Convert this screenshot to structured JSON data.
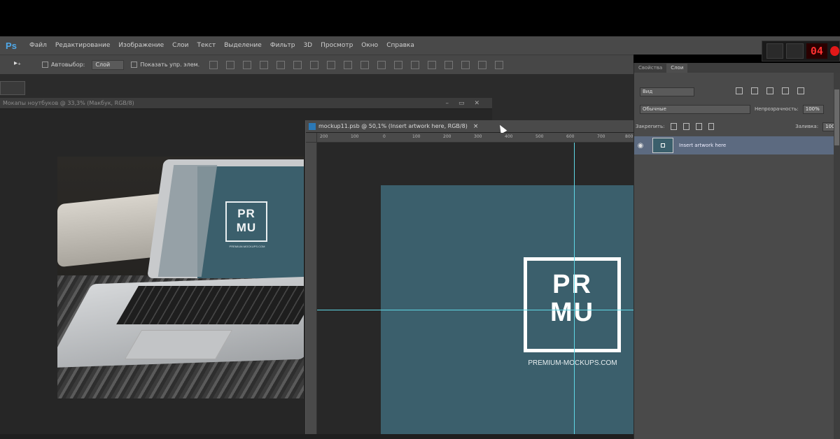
{
  "app": {
    "logo": "Ps"
  },
  "menu": [
    "Файл",
    "Редактирование",
    "Изображение",
    "Слои",
    "Текст",
    "Выделение",
    "Фильтр",
    "3D",
    "Просмотр",
    "Окно",
    "Справка"
  ],
  "options_bar": {
    "auto_select_label": "Автовыбор:",
    "auto_select_value": "Слой",
    "show_transform_label": "Показать упр. элем."
  },
  "recorder": {
    "digits": "04"
  },
  "document1": {
    "title": "Мокапы ноутбуков @ 33,3% (Макбук, RGB/8)"
  },
  "document2": {
    "tab_title": "mockup11.psb @ 50,1% (Insert artwork here, RGB/8)",
    "ruler_ticks": [
      "200",
      "100",
      "0",
      "100",
      "200",
      "300",
      "400",
      "500",
      "600",
      "700",
      "800"
    ]
  },
  "artwork": {
    "logo_top": "PR",
    "logo_bottom": "MU",
    "url": "PREMIUM-MOCKUPS.COM"
  },
  "layers_panel": {
    "tabs": [
      "Свойства",
      "Слои"
    ],
    "filter_label": "Вид",
    "blend_mode": "Обычные",
    "opacity_label": "Непрозрачность:",
    "opacity_value": "100%",
    "lock_label": "Закрепить:",
    "fill_label": "Заливка:",
    "fill_value": "100%",
    "layer_name": "Insert artwork here"
  },
  "colors": {
    "canvas": "#3b5f6c",
    "guides": "#5fd8e6",
    "ps_blue": "#4fa8e8",
    "selected_layer": "#5c6a80",
    "record_red": "#e01818"
  }
}
